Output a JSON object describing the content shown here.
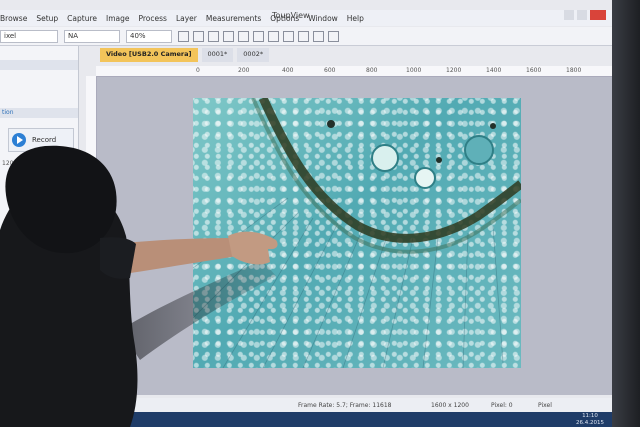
{
  "window": {
    "title": "ToupView",
    "menu": [
      "Browse",
      "Setup",
      "Capture",
      "Image",
      "Process",
      "Layer",
      "Measurements",
      "Options",
      "Window",
      "Help"
    ]
  },
  "toolbar": {
    "unit_value": "ixel",
    "magnification_value": "NA",
    "zoom_value": "40%"
  },
  "tabs": [
    {
      "label": "Video [USB2.0 Camera]"
    },
    {
      "label": "0001*"
    },
    {
      "label": "0002*"
    }
  ],
  "ruler": {
    "ticks": [
      "0",
      "200",
      "400",
      "600",
      "800",
      "1000",
      "1200",
      "1400",
      "1600",
      "1800"
    ]
  },
  "left_panel": {
    "section_label": "tion",
    "record_label": "Record",
    "value_label": "1200"
  },
  "status": {
    "frame_info": "Frame Rate: 5.7; Frame: 11618",
    "resolution": "1600 x 1200",
    "pixel": "Pixel: 0",
    "unit": "Pixel"
  },
  "taskbar": {
    "time": "11:10",
    "date": "26.4.2015"
  },
  "colors": {
    "stain_teal": "#4fb3bb",
    "xylem_ring": "#2e3a1f",
    "record_blue": "#2c7fd4",
    "active_tab": "#f3c45a"
  }
}
